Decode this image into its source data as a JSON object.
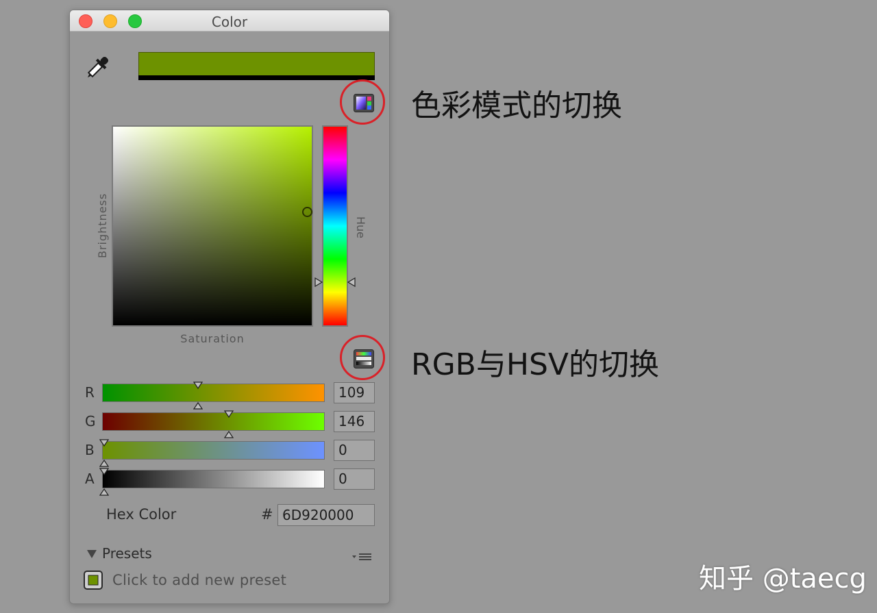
{
  "window": {
    "title": "Color"
  },
  "picker": {
    "selected_color": "#6D9200",
    "hue_color": "#B6F000",
    "mode_button_icon": "color-mode-icon",
    "model_switch_icon": "rgb-hsv-switch-icon",
    "eyedropper_icon": "eyedropper-icon",
    "brightness_label": "Brightness",
    "hue_label": "Hue",
    "saturation_label": "Saturation",
    "sv_cursor": {
      "saturation": 1.0,
      "brightness": 0.57
    },
    "hue_handle": 0.22
  },
  "channels": [
    {
      "label": "R",
      "value": "109",
      "level": 0.43
    },
    {
      "label": "G",
      "value": "146",
      "level": 0.57
    },
    {
      "label": "B",
      "value": "0",
      "level": 0.0
    },
    {
      "label": "A",
      "value": "0",
      "level": 0.0
    }
  ],
  "hex": {
    "label": "Hex Color",
    "prefix": "#",
    "value": "6D920000"
  },
  "presets": {
    "label": "Presets",
    "add_text": "Click to add new preset",
    "menu_icon": "dropdown-menu-icon"
  },
  "annotations": {
    "mode_switch": "色彩模式的切换",
    "rgb_hsv_switch": "RGB与HSV的切换",
    "circle_color": "#D92128"
  },
  "watermark": "知乎 @taecg"
}
